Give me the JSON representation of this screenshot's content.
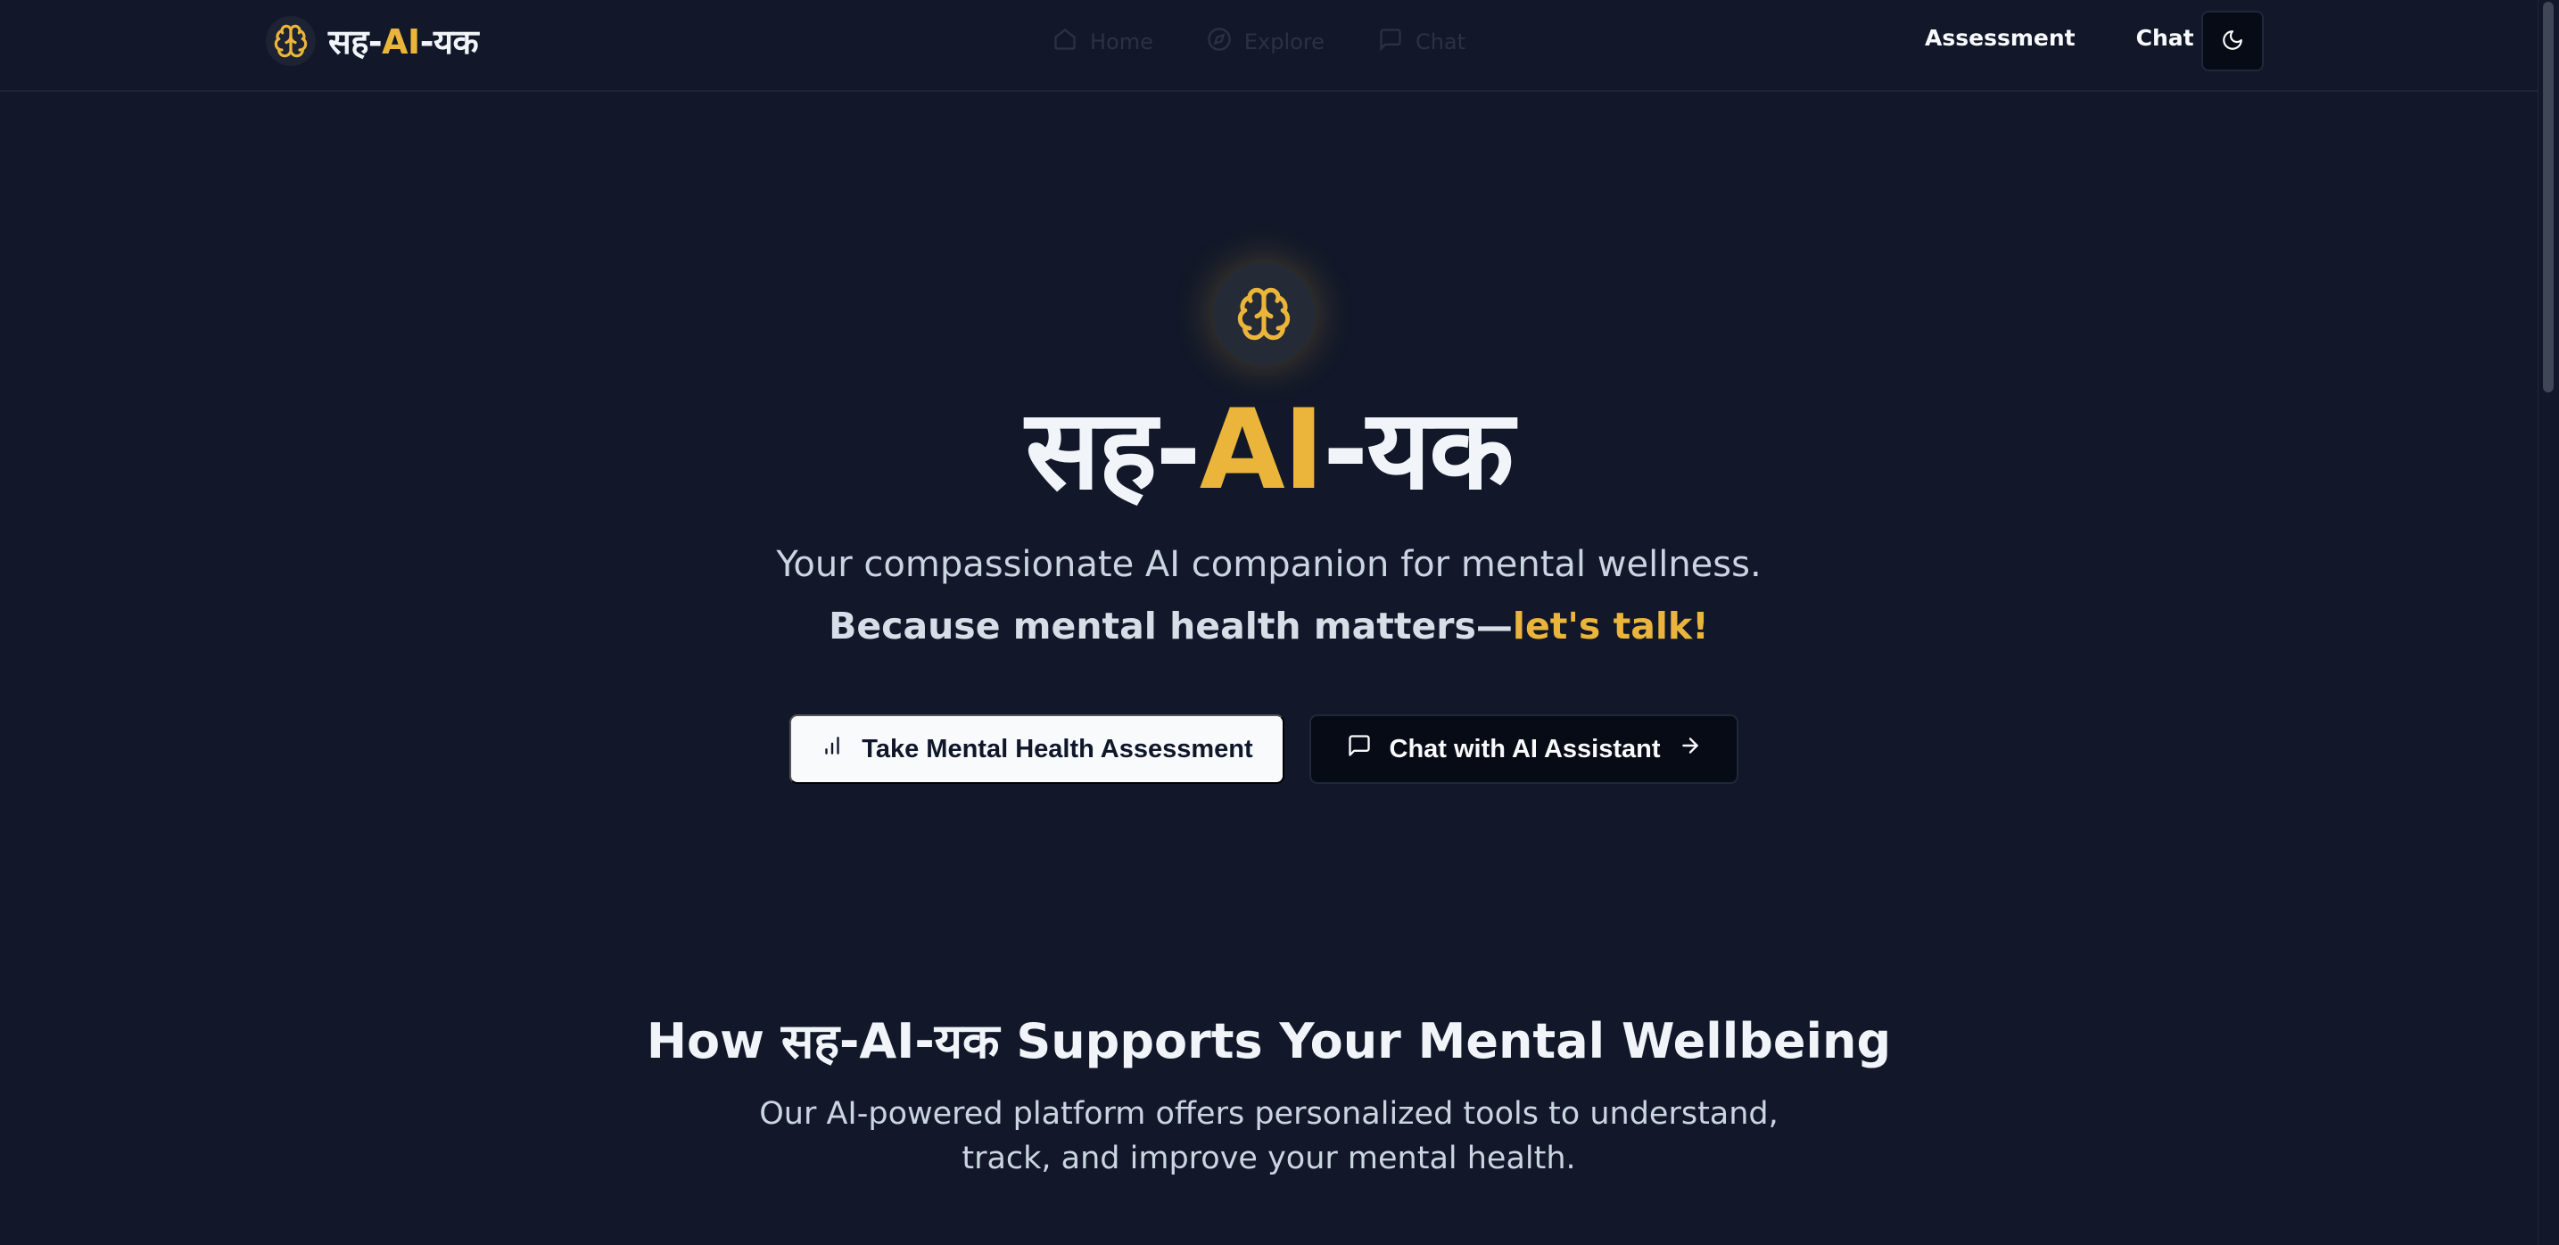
{
  "brand": {
    "pre": "सह-",
    "accent": "AI",
    "post": "-यक",
    "accent_color": "#eab53a"
  },
  "ghost_nav": {
    "items": [
      {
        "label": "Home",
        "icon": "home-icon"
      },
      {
        "label": "Explore",
        "icon": "compass-icon"
      },
      {
        "label": "Chat",
        "icon": "chat-icon"
      }
    ]
  },
  "nav": {
    "assessment": "Assessment",
    "chat": "Chat",
    "theme_icon": "moon-icon"
  },
  "hero": {
    "icon": "brain-icon",
    "title_pre": "सह-",
    "title_accent": "AI",
    "title_post": "-यक",
    "subtitle": "Your compassionate AI companion for mental wellness.",
    "tagline_main": "Because mental health matters—",
    "tagline_accent": "let's talk!",
    "cta_primary": "Take Mental Health Assessment",
    "cta_primary_icon": "bar-chart-icon",
    "cta_secondary": "Chat with AI Assistant",
    "cta_secondary_icon": "message-square-icon",
    "cta_secondary_trailing_icon": "arrow-right-icon"
  },
  "features": {
    "title_pre": "How ",
    "title_brand": "सह-AI-यक",
    "title_post": " Supports Your Mental Wellbeing",
    "description": "Our AI-powered platform offers personalized tools to understand, track, and improve your mental health."
  },
  "colors": {
    "background": "#121829",
    "accent": "#eab53a",
    "button_light": "#f8fafc",
    "button_dark": "#070b15"
  }
}
